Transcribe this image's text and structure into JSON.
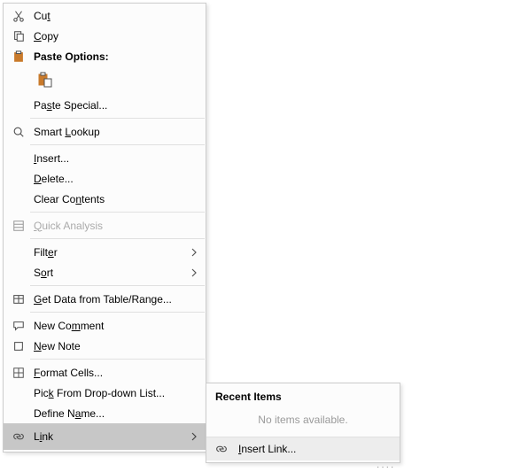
{
  "menu": {
    "cut": "Cut",
    "copy": "Copy",
    "paste_options": "Paste Options:",
    "paste_special": "Paste Special...",
    "smart_lookup": "Smart Lookup",
    "insert": "Insert...",
    "delete": "Delete...",
    "clear_contents": "Clear Contents",
    "quick_analysis": "Quick Analysis",
    "filter": "Filter",
    "sort": "Sort",
    "get_data": "Get Data from Table/Range...",
    "new_comment": "New Comment",
    "new_note": "New Note",
    "format_cells": "Format Cells...",
    "pick_list": "Pick From Drop-down List...",
    "define_name": "Define Name...",
    "link": "Link"
  },
  "submenu": {
    "header": "Recent Items",
    "empty": "No items available.",
    "insert_link": "Insert Link..."
  },
  "mnemonics": {
    "cut": "t",
    "copy": "C",
    "paste_special": "S",
    "smart_lookup": "L",
    "insert": "I",
    "delete": "D",
    "clear_contents": "n",
    "quick_analysis": "Q",
    "filter": "E",
    "sort": "O",
    "get_data": "G",
    "new_comment": "M",
    "new_note": "N",
    "format_cells": "F",
    "pick_list": "K",
    "define_name": "A",
    "link": "I",
    "insert_link": "I"
  }
}
